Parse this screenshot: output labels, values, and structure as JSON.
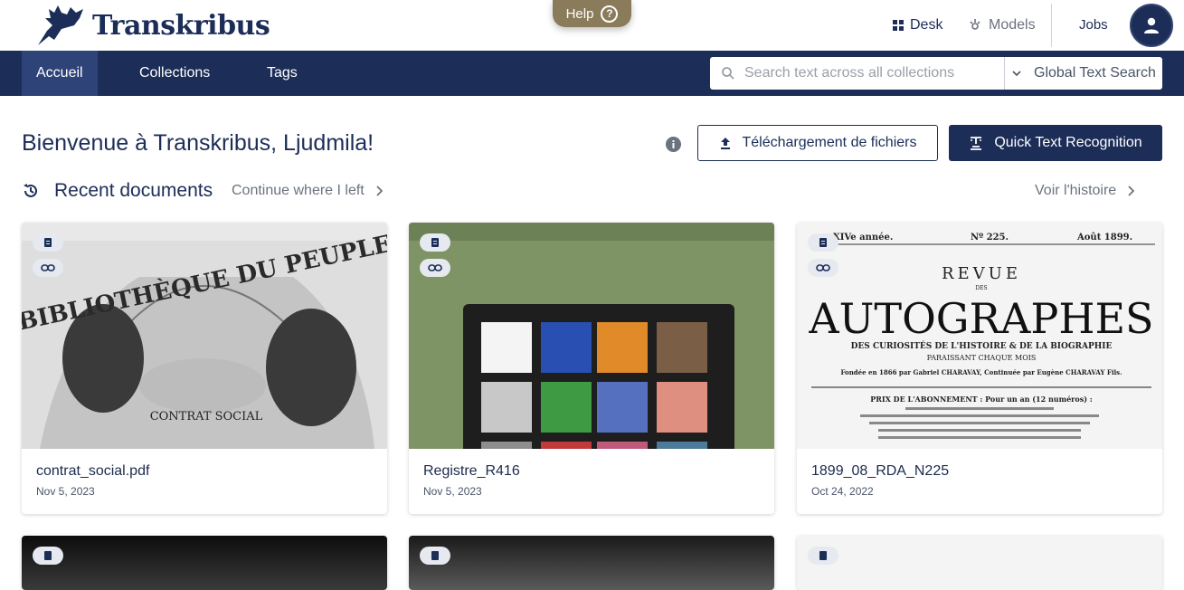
{
  "app": {
    "logo_text": "Transkribus"
  },
  "help": {
    "label": "Help"
  },
  "topnav": {
    "desk": "Desk",
    "models": "Models",
    "jobs": "Jobs"
  },
  "navbar": {
    "tabs": [
      {
        "label": "Accueil",
        "active": true
      },
      {
        "label": "Collections",
        "active": false
      },
      {
        "label": "Tags",
        "active": false
      }
    ],
    "search": {
      "placeholder": "Search text across all collections",
      "scope": "Global Text Search"
    }
  },
  "main": {
    "welcome": "Bienvenue à Transkribus, Ljudmila!",
    "upload_button": "Téléchargement de fichiers",
    "qtr_button": "Quick Text Recognition",
    "recent": {
      "title": "Recent documents",
      "continue_label": "Continue where I left",
      "history_label": "Voir l'histoire"
    },
    "documents": [
      {
        "name": "contrat_social.pdf",
        "date": "Nov 5, 2023",
        "thumb_title": "BIBLIOTHÈQUE DU PEUPLE",
        "thumb_subtitle": "CONTRAT SOCIAL"
      },
      {
        "name": "Registre_R416",
        "date": "Nov 5, 2023"
      },
      {
        "name": "1899_08_RDA_N225",
        "date": "Oct 24, 2022",
        "thumb_header_left": "XIVe année.",
        "thumb_header_mid": "Nº 225.",
        "thumb_header_right": "Août 1899.",
        "thumb_title_top": "REVUE",
        "thumb_title_des": "DES",
        "thumb_title_main": "AUTOGRAPHES",
        "thumb_line1": "DES CURIOSITÉS DE L'HISTOIRE & DE LA BIOGRAPHIE",
        "thumb_line2": "PARAISSANT CHAQUE MOIS",
        "thumb_line3": "Fondée en 1866 par Gabriel CHARAVAY, Continuée par Eugène CHARAVAY Fils.",
        "thumb_line4": "PRIX DE L'ABONNEMENT : Pour un an (12 numéros) :"
      }
    ]
  },
  "colors": {
    "navy": "#1c2d58",
    "help_pill": "#8a7b5a"
  }
}
